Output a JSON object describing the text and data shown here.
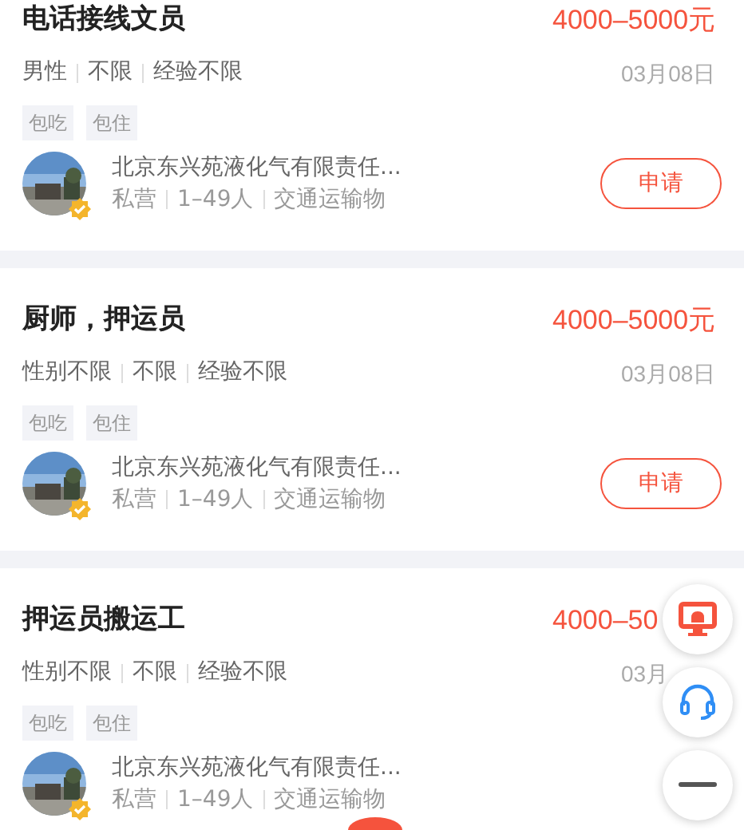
{
  "jobs": [
    {
      "title": "电话接线文员",
      "salary": "4000–5000元",
      "requirements": [
        "男性",
        "不限",
        "经验不限"
      ],
      "date": "03月08日",
      "tags": [
        "包吃",
        "包住"
      ],
      "company": {
        "name": "北京东兴苑液化气有限责任...",
        "ownership": "私营",
        "size": "1–49人",
        "industry": "交通运输物",
        "verified": true
      },
      "apply": "申请"
    },
    {
      "title": "厨师，押运员",
      "salary": "4000–5000元",
      "requirements": [
        "性别不限",
        "不限",
        "经验不限"
      ],
      "date": "03月08日",
      "tags": [
        "包吃",
        "包住"
      ],
      "company": {
        "name": "北京东兴苑液化气有限责任...",
        "ownership": "私营",
        "size": "1–49人",
        "industry": "交通运输物",
        "verified": true
      },
      "apply": "申请"
    },
    {
      "title": "押运员搬运工",
      "salary": "4000–50",
      "requirements": [
        "性别不限",
        "不限",
        "经验不限"
      ],
      "date": "03月",
      "tags": [
        "包吃",
        "包住"
      ],
      "company": {
        "name": "北京东兴苑液化气有限责任...",
        "ownership": "私营",
        "size": "1–49人",
        "industry": "交通运输物",
        "verified": true
      }
    }
  ]
}
